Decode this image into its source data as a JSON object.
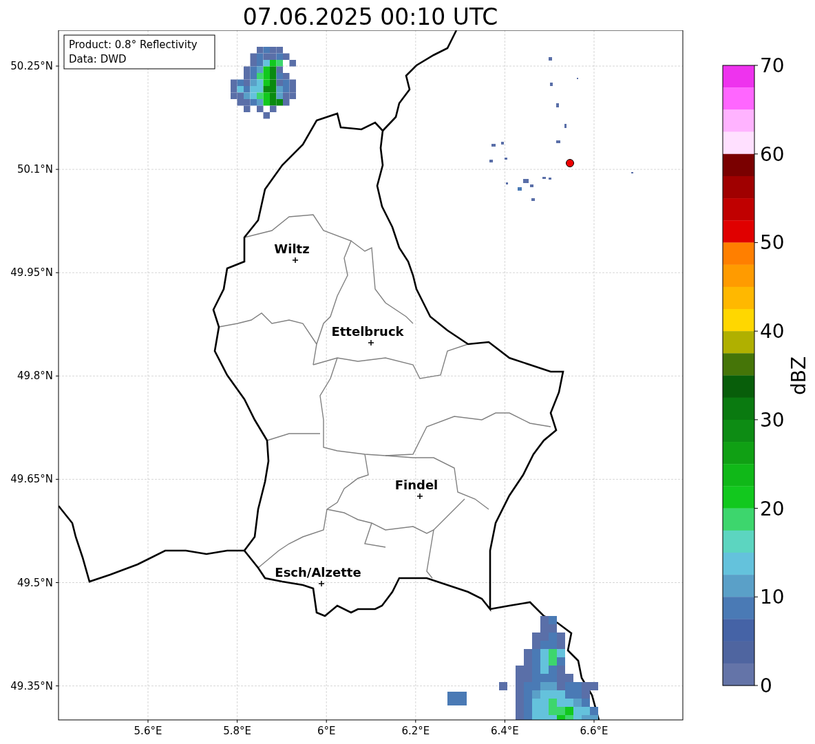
{
  "title": "07.06.2025 00:10 UTC",
  "info_box": {
    "lines": [
      "Product: 0.8° Reflectivity",
      "Data: DWD"
    ]
  },
  "map": {
    "lat_labels": [
      "50.25°N",
      "50.1°N",
      "49.95°N",
      "49.8°N",
      "49.65°N",
      "49.5°N",
      "49.35°N"
    ],
    "lon_labels": [
      "5.6°E",
      "5.8°E",
      "6°E",
      "6.2°E",
      "6.4°E",
      "6.6°E"
    ],
    "cities": [
      {
        "name": "Wiltz"
      },
      {
        "name": "Ettelbruck"
      },
      {
        "name": "Findel"
      },
      {
        "name": "Esch/Alzette"
      }
    ]
  },
  "colorbar": {
    "label": "dBZ",
    "ticks": [
      "70",
      "60",
      "50",
      "40",
      "30",
      "20",
      "10",
      "0"
    ],
    "bins": [
      {
        "color": "#ee33ee"
      },
      {
        "color": "#ff66ff"
      },
      {
        "color": "#ffb3ff"
      },
      {
        "color": "#ffe0ff"
      },
      {
        "color": "#7a0000"
      },
      {
        "color": "#a00000"
      },
      {
        "color": "#c00000"
      },
      {
        "color": "#e00000"
      },
      {
        "color": "#ff7f00"
      },
      {
        "color": "#ff9b00"
      },
      {
        "color": "#ffb800"
      },
      {
        "color": "#ffd700"
      },
      {
        "color": "#b0b000"
      },
      {
        "color": "#457508"
      },
      {
        "color": "#085e0a"
      },
      {
        "color": "#0a7a10"
      },
      {
        "color": "#0d8c14"
      },
      {
        "color": "#10a014"
      },
      {
        "color": "#10b818"
      },
      {
        "color": "#12c81e"
      },
      {
        "color": "#3dd66d"
      },
      {
        "color": "#5cd5c0"
      },
      {
        "color": "#64c2dc"
      },
      {
        "color": "#5aa0c8"
      },
      {
        "color": "#4a7ab5"
      },
      {
        "color": "#4563a6"
      },
      {
        "color": "#4f65a0"
      },
      {
        "color": "#6474a8"
      }
    ]
  }
}
